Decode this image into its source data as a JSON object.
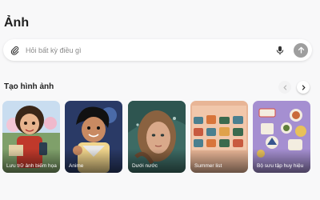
{
  "page": {
    "title": "Ảnh"
  },
  "search": {
    "placeholder": "Hỏi bất kỳ điều gì",
    "value": "",
    "attach_icon": "paperclip-icon",
    "mic_icon": "microphone-icon",
    "send_icon": "arrow-up-icon"
  },
  "section": {
    "title": "Tạo hình ảnh",
    "prev_icon": "chevron-left-icon",
    "next_icon": "chevron-right-icon"
  },
  "cards": [
    {
      "label": "Lưu trữ ảnh biếm họa"
    },
    {
      "label": "Anime"
    },
    {
      "label": "Dưới nước"
    },
    {
      "label": "Summer list"
    },
    {
      "label": "Bộ sưu tập huy hiệu"
    }
  ],
  "colors": {
    "send_button": "#9e9e9e",
    "background": "#f8f8f9"
  }
}
